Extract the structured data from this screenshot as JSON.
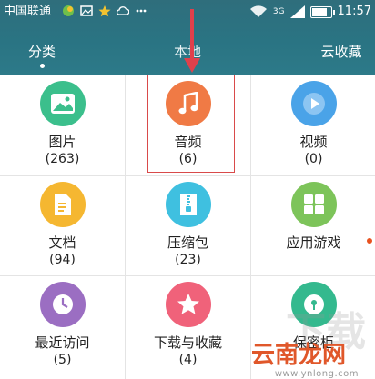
{
  "status_bar": {
    "carrier": "中国联通",
    "network": "3G",
    "time": "11:57",
    "battery_level": 0.8
  },
  "tabs": [
    {
      "label": "分类",
      "active": true
    },
    {
      "label": "本地",
      "active": false
    },
    {
      "label": "云收藏",
      "active": false
    }
  ],
  "categories": [
    {
      "label": "图片",
      "count": "(263)",
      "icon": "image-icon",
      "color": "#3bbf8c"
    },
    {
      "label": "音频",
      "count": "(6)",
      "icon": "music-icon",
      "color": "#f07a45"
    },
    {
      "label": "视频",
      "count": "(0)",
      "icon": "video-icon",
      "color": "#4aa3e8"
    },
    {
      "label": "文档",
      "count": "(94)",
      "icon": "document-icon",
      "color": "#f5b731"
    },
    {
      "label": "压缩包",
      "count": "(23)",
      "icon": "archive-icon",
      "color": "#3fc0e0"
    },
    {
      "label": "应用游戏",
      "count": "",
      "icon": "apps-icon",
      "color": "#7dc45a"
    },
    {
      "label": "最近访问",
      "count": "(5)",
      "icon": "clock-icon",
      "color": "#9b6ec2"
    },
    {
      "label": "下载与收藏",
      "count": "(4)",
      "icon": "star-icon",
      "color": "#f0627a"
    },
    {
      "label": "保密柜",
      "count": "",
      "icon": "safe-icon",
      "color": "#34b98e"
    }
  ],
  "watermark": {
    "big": "下载",
    "brand": "云南龙网",
    "url": "www.ynlong.com"
  }
}
